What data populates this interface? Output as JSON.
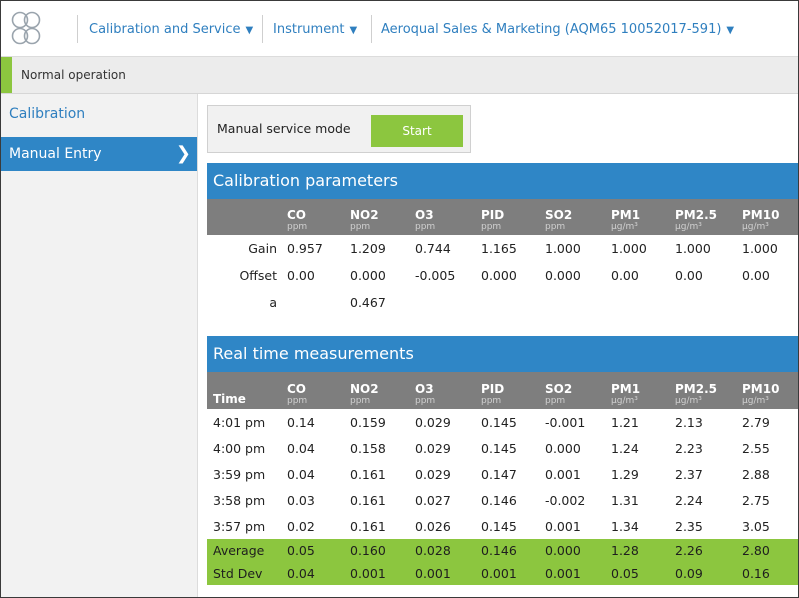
{
  "nav": {
    "section": "Calibration and Service",
    "instrument": "Instrument",
    "site": "Aeroqual Sales & Marketing (AQM65 10052017-591)"
  },
  "status": {
    "text": "Normal operation"
  },
  "sidebar": {
    "heading": "Calibration",
    "items": [
      {
        "label": "Manual Entry",
        "selected": true
      }
    ]
  },
  "service": {
    "label": "Manual service mode",
    "button": "Start"
  },
  "colors": {
    "accent_blue": "#2f86c6",
    "accent_green": "#8cc63f",
    "header_gray": "#7e7e7e"
  },
  "columns": [
    {
      "name": "CO",
      "unit": "ppm"
    },
    {
      "name": "NO2",
      "unit": "ppm"
    },
    {
      "name": "O3",
      "unit": "ppm"
    },
    {
      "name": "PID",
      "unit": "ppm"
    },
    {
      "name": "SO2",
      "unit": "ppm"
    },
    {
      "name": "PM1",
      "unit": "µg/m³"
    },
    {
      "name": "PM2.5",
      "unit": "µg/m³"
    },
    {
      "name": "PM10",
      "unit": "µg/m³"
    }
  ],
  "calibration": {
    "title": "Calibration parameters",
    "rows": [
      {
        "label": "Gain",
        "values": [
          "0.957",
          "1.209",
          "0.744",
          "1.165",
          "1.000",
          "1.000",
          "1.000",
          "1.000"
        ]
      },
      {
        "label": "Offset",
        "values": [
          "0.00",
          "0.000",
          "-0.005",
          "0.000",
          "0.000",
          "0.00",
          "0.00",
          "0.00"
        ]
      },
      {
        "label": "a",
        "values": [
          "",
          "0.467",
          "",
          "",
          "",
          "",
          "",
          ""
        ]
      }
    ]
  },
  "realtime": {
    "title": "Real time measurements",
    "time_header": "Time",
    "rows": [
      {
        "time": "4:01 pm",
        "values": [
          "0.14",
          "0.159",
          "0.029",
          "0.145",
          "-0.001",
          "1.21",
          "2.13",
          "2.79"
        ]
      },
      {
        "time": "4:00 pm",
        "values": [
          "0.04",
          "0.158",
          "0.029",
          "0.145",
          "0.000",
          "1.24",
          "2.23",
          "2.55"
        ]
      },
      {
        "time": "3:59 pm",
        "values": [
          "0.04",
          "0.161",
          "0.029",
          "0.147",
          "0.001",
          "1.29",
          "2.37",
          "2.88"
        ]
      },
      {
        "time": "3:58 pm",
        "values": [
          "0.03",
          "0.161",
          "0.027",
          "0.146",
          "-0.002",
          "1.31",
          "2.24",
          "2.75"
        ]
      },
      {
        "time": "3:57 pm",
        "values": [
          "0.02",
          "0.161",
          "0.026",
          "0.145",
          "0.001",
          "1.34",
          "2.35",
          "3.05"
        ]
      }
    ],
    "stats": [
      {
        "label": "Average",
        "values": [
          "0.05",
          "0.160",
          "0.028",
          "0.146",
          "0.000",
          "1.28",
          "2.26",
          "2.80"
        ]
      },
      {
        "label": "Std Dev",
        "values": [
          "0.04",
          "0.001",
          "0.001",
          "0.001",
          "0.001",
          "0.05",
          "0.09",
          "0.16"
        ]
      }
    ]
  }
}
